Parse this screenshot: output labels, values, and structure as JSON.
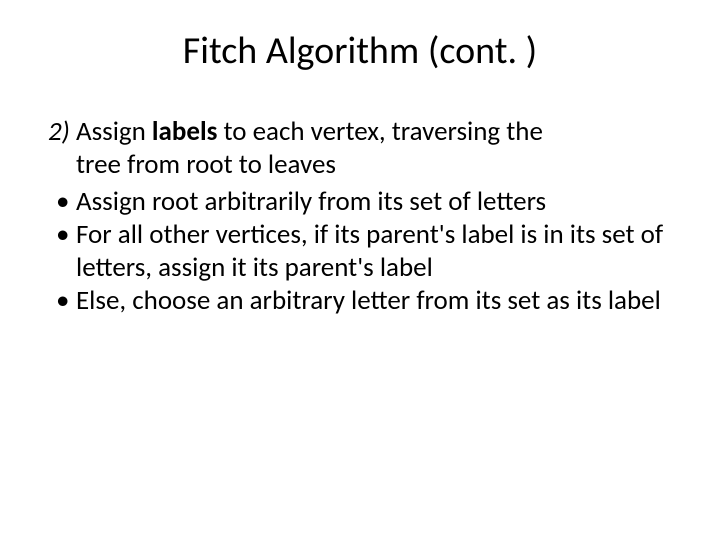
{
  "slide": {
    "title": "Fitch Algorithm (cont. )",
    "step_number": "2)",
    "step_text_before_bold": "Assign ",
    "step_text_bold": "labels",
    "step_text_after_bold": " to each vertex, traversing the",
    "step_line2": "tree from root to leaves",
    "bullets": [
      "Assign root arbitrarily from its set of letters",
      "For all other vertices, if its parent's label is in its set of letters, assign it its parent's label",
      "Else, choose an arbitrary letter from its set as its label"
    ],
    "bullet_char": "•"
  }
}
